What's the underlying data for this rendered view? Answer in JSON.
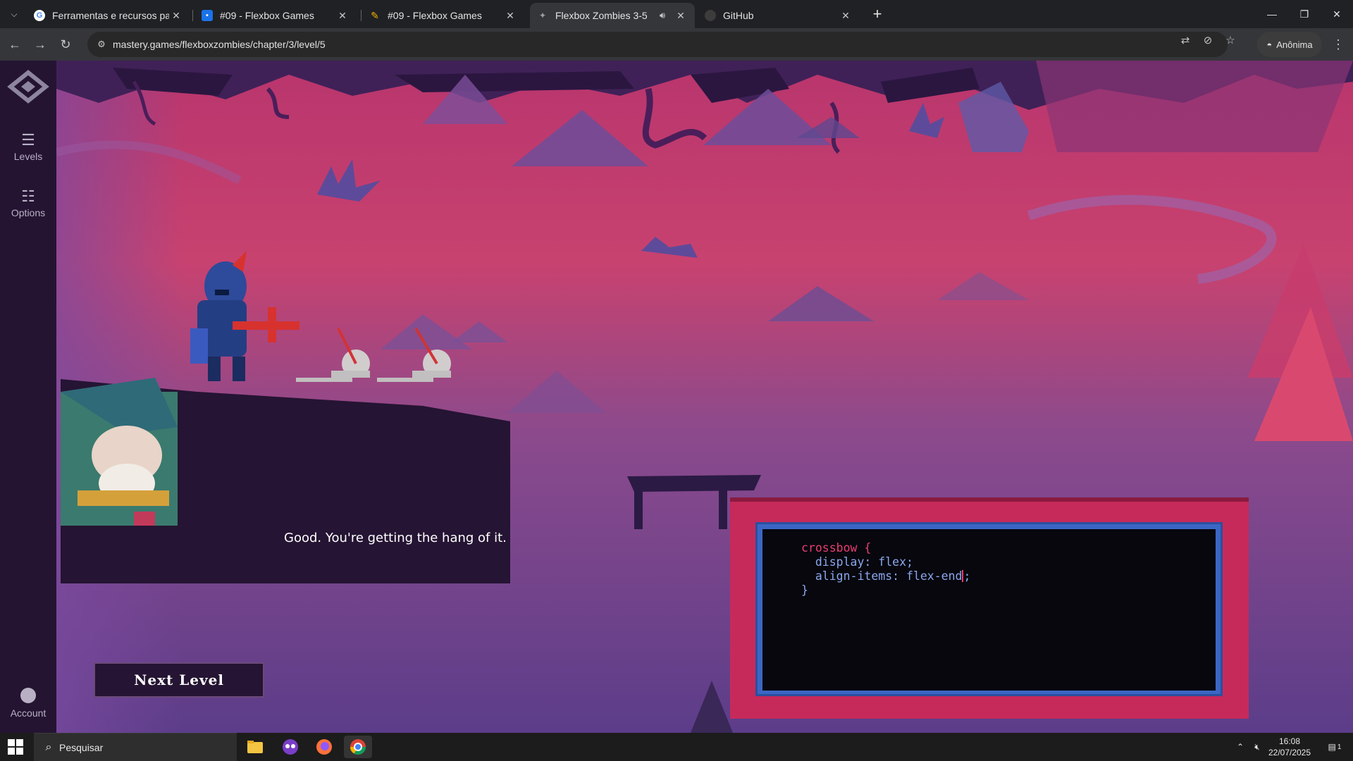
{
  "browser": {
    "tabs": [
      {
        "title": "Ferramentas e recursos para o ensino",
        "icon": "google-g-icon"
      },
      {
        "title": "#09 - Flexbox Games",
        "icon": "classroom-icon"
      },
      {
        "title": "#09 - Flexbox Games",
        "icon": "pencil-icon"
      },
      {
        "title": "Flexbox Zombies 3-5",
        "icon": "game-icon",
        "active": true
      },
      {
        "title": "GitHub",
        "icon": "github-icon"
      }
    ],
    "url": "mastery.games/flexboxzombies/chapter/3/level/5",
    "profile_label": "Anônima"
  },
  "sidebar": {
    "levels_label": "Levels",
    "options_label": "Options",
    "account_label": "Account"
  },
  "dialog": {
    "text": "Good. You're getting the hang of it.",
    "next_button": "Next Level"
  },
  "editor": {
    "selector": "crossbow {",
    "line1": "  display: flex;",
    "line2": "  align-items: flex-end",
    "line2_end": ";",
    "closing": "}"
  },
  "taskbar": {
    "search_placeholder": "Pesquisar",
    "time": "16:08",
    "date": "22/07/2025",
    "notification_count": "1"
  },
  "colors": {
    "sidebar_bg": "#241432",
    "sky_top": "#cc3f73",
    "sky_bottom": "#6a4a9a",
    "selector_color": "#ea3d72",
    "property_color": "#8ba7ee",
    "frame_red": "#c62a5a",
    "frame_blue": "#3a66c4"
  }
}
